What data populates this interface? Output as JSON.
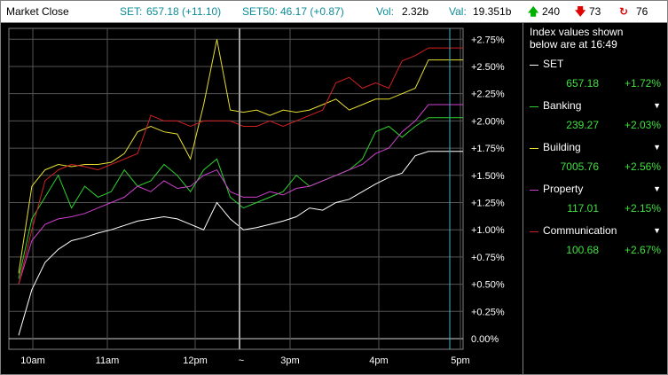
{
  "status_bar": {
    "market_state": "Market Close",
    "set_label": "SET:",
    "set_value": "657.18 (+11.10)",
    "set50_label": "SET50:",
    "set50_value": "46.17 (+0.87)",
    "vol_label": "Vol:",
    "vol_value": "2.32b",
    "val_label": "Val:",
    "val_value": "19.351b",
    "advances": "240",
    "declines": "73",
    "unchanged": "76",
    "up_arrow_icon": "arrow-up-icon",
    "down_arrow_icon": "arrow-down-icon",
    "unchanged_icon": "cycle-icon"
  },
  "sidebar": {
    "note_line1": "Index values shown",
    "note_line2": "below are at 16:49",
    "indices": [
      {
        "name": "SET",
        "value": "657.18",
        "change": "+1.72%",
        "color": "#ffffff"
      },
      {
        "name": "Banking",
        "value": "239.27",
        "change": "+2.03%",
        "color": "#2ed12e"
      },
      {
        "name": "Building",
        "value": "7005.76",
        "change": "+2.56%",
        "color": "#e8e030"
      },
      {
        "name": "Property",
        "value": "117.01",
        "change": "+2.15%",
        "color": "#d040d0"
      },
      {
        "name": "Communication",
        "value": "100.68",
        "change": "+2.67%",
        "color": "#d02020"
      }
    ]
  },
  "chart_data": {
    "type": "line",
    "x_ticks": [
      "10am",
      "11am",
      "12pm",
      "~",
      "3pm",
      "4pm",
      "5pm"
    ],
    "y_ticks": [
      "0.00%",
      "+0.25%",
      "+0.50%",
      "+0.75%",
      "+1.00%",
      "+1.25%",
      "+1.50%",
      "+1.75%",
      "+2.00%",
      "+2.25%",
      "+2.50%",
      "+2.75%"
    ],
    "ylim": [
      0,
      2.85
    ],
    "y_unit": "%",
    "series": [
      {
        "name": "SET",
        "color": "#ffffff",
        "values": [
          0.03,
          0.45,
          0.7,
          0.82,
          0.9,
          0.93,
          0.97,
          1.0,
          1.04,
          1.08,
          1.1,
          1.12,
          1.1,
          1.05,
          1.0,
          1.25,
          1.1,
          1.0,
          1.02,
          1.05,
          1.08,
          1.12,
          1.2,
          1.18,
          1.25,
          1.28,
          1.35,
          1.42,
          1.48,
          1.52,
          1.68,
          1.72,
          1.72,
          1.72
        ]
      },
      {
        "name": "Banking",
        "color": "#2ed12e",
        "values": [
          0.55,
          1.1,
          1.3,
          1.5,
          1.2,
          1.4,
          1.3,
          1.35,
          1.55,
          1.4,
          1.45,
          1.6,
          1.5,
          1.35,
          1.55,
          1.65,
          1.3,
          1.2,
          1.25,
          1.3,
          1.35,
          1.5,
          1.4,
          1.45,
          1.5,
          1.55,
          1.65,
          1.9,
          1.95,
          1.85,
          1.95,
          2.03,
          2.03,
          2.03
        ]
      },
      {
        "name": "Building",
        "color": "#e8e030",
        "values": [
          0.6,
          1.4,
          1.55,
          1.6,
          1.58,
          1.6,
          1.6,
          1.62,
          1.7,
          1.9,
          1.95,
          1.9,
          1.88,
          1.65,
          2.15,
          2.75,
          2.1,
          2.08,
          2.1,
          2.05,
          2.1,
          2.08,
          2.1,
          2.15,
          2.2,
          2.1,
          2.15,
          2.2,
          2.2,
          2.25,
          2.3,
          2.56,
          2.56,
          2.56
        ]
      },
      {
        "name": "Property",
        "color": "#d040d0",
        "values": [
          0.5,
          0.9,
          1.05,
          1.1,
          1.12,
          1.15,
          1.2,
          1.25,
          1.3,
          1.4,
          1.35,
          1.45,
          1.38,
          1.4,
          1.5,
          1.55,
          1.35,
          1.3,
          1.3,
          1.35,
          1.32,
          1.38,
          1.4,
          1.45,
          1.5,
          1.55,
          1.6,
          1.7,
          1.75,
          1.9,
          2.0,
          2.15,
          2.15,
          2.15
        ]
      },
      {
        "name": "Communication",
        "color": "#d02020",
        "values": [
          0.5,
          1.0,
          1.45,
          1.55,
          1.6,
          1.58,
          1.55,
          1.6,
          1.65,
          1.7,
          2.05,
          2.0,
          2.0,
          1.95,
          2.0,
          2.0,
          2.0,
          1.95,
          1.95,
          2.0,
          1.95,
          2.0,
          2.05,
          2.1,
          2.35,
          2.4,
          2.3,
          2.35,
          2.3,
          2.55,
          2.6,
          2.67,
          2.67,
          2.67
        ]
      }
    ]
  }
}
